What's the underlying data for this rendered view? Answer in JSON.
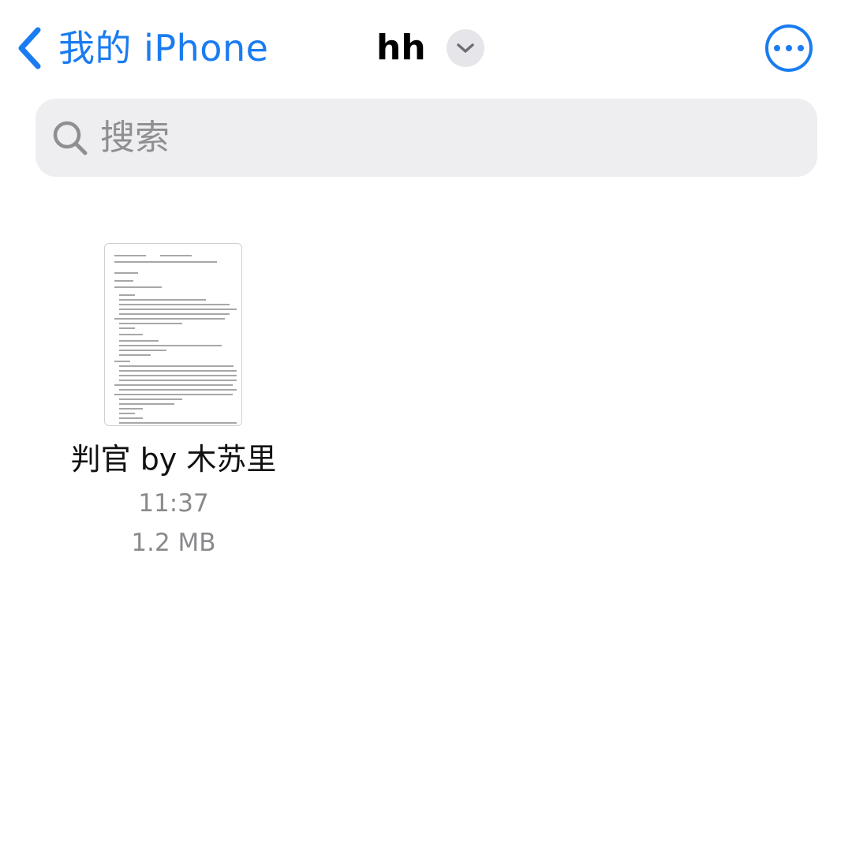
{
  "nav": {
    "back_label": "我的 iPhone",
    "title": "hh",
    "back_icon": "chevron-left-icon",
    "title_menu_icon": "chevron-down-icon",
    "more_icon": "ellipsis-circle-icon"
  },
  "search": {
    "placeholder": "搜索",
    "icon": "magnifying-glass-icon"
  },
  "files": [
    {
      "name": "判官 by 木苏里",
      "time": "11:37",
      "size": "1.2 MB",
      "icon": "document-thumbnail"
    }
  ],
  "colors": {
    "accent": "#1a7cf0",
    "secondary_text": "#8a8a8e",
    "search_bg": "#eeeef0"
  }
}
